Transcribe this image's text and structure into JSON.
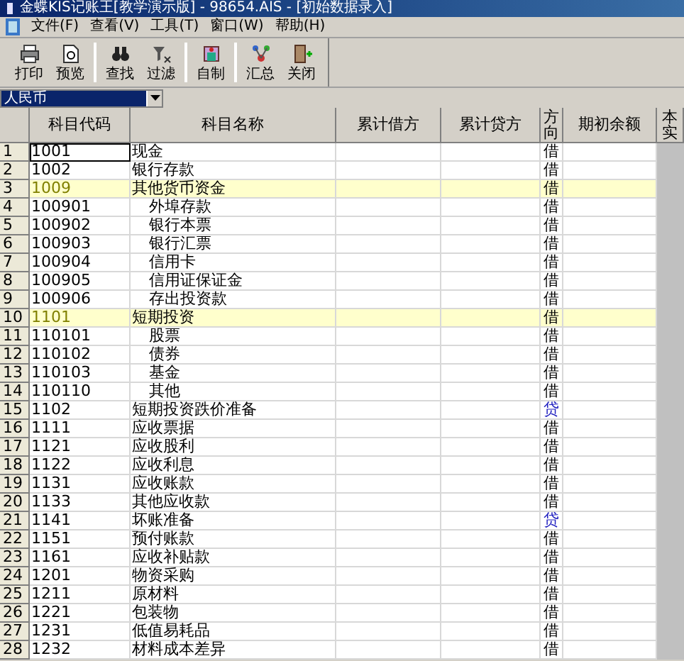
{
  "window": {
    "title": "金蝶KIS记账王[教学演示版] - 98654.AIS - [初始数据录入]"
  },
  "menu": [
    {
      "label": "文件(F)"
    },
    {
      "label": "查看(V)"
    },
    {
      "label": "工具(T)"
    },
    {
      "label": "窗口(W)"
    },
    {
      "label": "帮助(H)"
    }
  ],
  "toolbar": [
    {
      "label": "打印",
      "kind": "print",
      "group_start": false
    },
    {
      "label": "预览",
      "kind": "preview",
      "group_start": false
    },
    {
      "label": "查找",
      "kind": "find",
      "group_start": true
    },
    {
      "label": "过滤",
      "kind": "filter",
      "group_start": false
    },
    {
      "label": "自制",
      "kind": "custom",
      "group_start": true
    },
    {
      "label": "汇总",
      "kind": "summary",
      "group_start": true
    },
    {
      "label": "关闭",
      "kind": "close",
      "group_start": false
    }
  ],
  "currency": {
    "value": "人民币"
  },
  "table": {
    "columns": [
      "科目代码",
      "科目名称",
      "累计借方",
      "累计贷方",
      "方向",
      "期初余额",
      "本实"
    ],
    "rows": [
      {
        "num": "1",
        "code": "1001",
        "name": "现金",
        "direction": "借",
        "credit": false,
        "selected": true
      },
      {
        "num": "2",
        "code": "1002",
        "name": "银行存款",
        "direction": "借",
        "credit": false,
        "selected": false
      },
      {
        "num": "3",
        "code": "1009",
        "name": "其他货币资金",
        "direction": "借",
        "credit": false,
        "selected": false,
        "children": [
          {
            "num": "4",
            "code": "100901",
            "name": "外埠存款",
            "direction": "借",
            "credit": false,
            "selected": false
          },
          {
            "num": "5",
            "code": "100902",
            "name": "银行本票",
            "direction": "借",
            "credit": false,
            "selected": false
          },
          {
            "num": "6",
            "code": "100903",
            "name": "银行汇票",
            "direction": "借",
            "credit": false,
            "selected": false
          },
          {
            "num": "7",
            "code": "100904",
            "name": "信用卡",
            "direction": "借",
            "credit": false,
            "selected": false
          },
          {
            "num": "8",
            "code": "100905",
            "name": "信用证保证金",
            "direction": "借",
            "credit": false,
            "selected": false
          },
          {
            "num": "9",
            "code": "100906",
            "name": "存出投资款",
            "direction": "借",
            "credit": false,
            "selected": false
          }
        ]
      },
      {
        "num": "10",
        "code": "1101",
        "name": "短期投资",
        "direction": "借",
        "credit": false,
        "selected": false,
        "children": [
          {
            "num": "11",
            "code": "110101",
            "name": "股票",
            "direction": "借",
            "credit": false,
            "selected": false
          },
          {
            "num": "12",
            "code": "110102",
            "name": "债券",
            "direction": "借",
            "credit": false,
            "selected": false
          },
          {
            "num": "13",
            "code": "110103",
            "name": "基金",
            "direction": "借",
            "credit": false,
            "selected": false
          },
          {
            "num": "14",
            "code": "110110",
            "name": "其他",
            "direction": "借",
            "credit": false,
            "selected": false
          }
        ]
      },
      {
        "num": "15",
        "code": "1102",
        "name": "短期投资跌价准备",
        "direction": "贷",
        "credit": true,
        "selected": false
      },
      {
        "num": "16",
        "code": "1111",
        "name": "应收票据",
        "direction": "借",
        "credit": false,
        "selected": false
      },
      {
        "num": "17",
        "code": "1121",
        "name": "应收股利",
        "direction": "借",
        "credit": false,
        "selected": false
      },
      {
        "num": "18",
        "code": "1122",
        "name": "应收利息",
        "direction": "借",
        "credit": false,
        "selected": false
      },
      {
        "num": "19",
        "code": "1131",
        "name": "应收账款",
        "direction": "借",
        "credit": false,
        "selected": false
      },
      {
        "num": "20",
        "code": "1133",
        "name": "其他应收款",
        "direction": "借",
        "credit": false,
        "selected": false
      },
      {
        "num": "21",
        "code": "1141",
        "name": "坏账准备",
        "direction": "贷",
        "credit": true,
        "selected": false
      },
      {
        "num": "22",
        "code": "1151",
        "name": "预付账款",
        "direction": "借",
        "credit": false,
        "selected": false
      },
      {
        "num": "23",
        "code": "1161",
        "name": "应收补贴款",
        "direction": "借",
        "credit": false,
        "selected": false
      },
      {
        "num": "24",
        "code": "1201",
        "name": "物资采购",
        "direction": "借",
        "credit": false,
        "selected": false
      },
      {
        "num": "25",
        "code": "1211",
        "name": "原材料",
        "direction": "借",
        "credit": false,
        "selected": false
      },
      {
        "num": "26",
        "code": "1221",
        "name": "包装物",
        "direction": "借",
        "credit": false,
        "selected": false
      },
      {
        "num": "27",
        "code": "1231",
        "name": "低值易耗品",
        "direction": "借",
        "credit": false,
        "selected": false
      },
      {
        "num": "28",
        "code": "1232",
        "name": "材料成本差异",
        "direction": "借",
        "credit": false,
        "selected": false
      }
    ]
  }
}
